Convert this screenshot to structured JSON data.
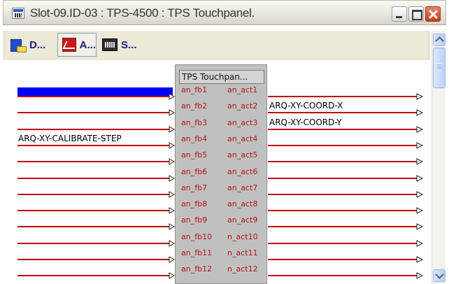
{
  "window": {
    "title": "Slot-09.ID-03 : TPS-4500 : TPS Touchpanel.",
    "controls": [
      "minimize",
      "maximize",
      "close"
    ]
  },
  "toolbar": {
    "tabs": [
      {
        "key": "D",
        "label": "D...",
        "icon": "display-icon",
        "active": false
      },
      {
        "key": "A",
        "label": "A...",
        "icon": "analog-icon",
        "active": true
      },
      {
        "key": "S",
        "label": "S...",
        "icon": "serial-icon",
        "active": false
      }
    ]
  },
  "symbol": {
    "title": "TPS Touchpan...",
    "inputs": [
      "an_fb1",
      "an_fb2",
      "an_fb3",
      "an_fb4",
      "an_fb5",
      "an_fb6",
      "an_fb7",
      "an_fb8",
      "an_fb9",
      "an_fb10",
      "an_fb11",
      "an_fb12"
    ],
    "outputs": [
      "an_act1",
      "an_act2",
      "an_act3",
      "an_act4",
      "an_act5",
      "an_act6",
      "an_act7",
      "an_act8",
      "an_act9",
      "n_act10",
      "n_act11",
      "n_act12"
    ]
  },
  "input_signals": [
    "",
    "",
    "",
    "ARQ-XY-CALIBRATE-STEP",
    "",
    "",
    "",
    "",
    "",
    "",
    "",
    ""
  ],
  "output_signals": [
    "",
    "ARQ-XY-COORD-X",
    "ARQ-XY-COORD-Y",
    "",
    "",
    "",
    "",
    "",
    "",
    "",
    "",
    ""
  ],
  "colors": {
    "signal_line": "#c00000",
    "port_text": "#b41414",
    "selection": "#0000ff",
    "panel": "#c0c0c0"
  }
}
